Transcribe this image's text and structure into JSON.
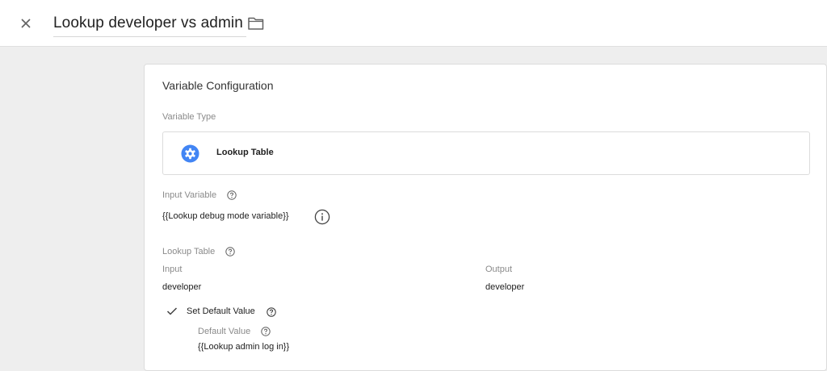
{
  "header": {
    "title": "Lookup developer vs admin",
    "close_icon": "close-icon",
    "folder_icon": "folder-icon"
  },
  "card": {
    "title": "Variable Configuration",
    "variable_type": {
      "label": "Variable Type",
      "name": "Lookup Table",
      "icon": "gear-icon",
      "icon_color": "#4285f4"
    },
    "input_variable": {
      "label": "Input Variable",
      "value": "{{Lookup debug mode variable}}"
    },
    "lookup_table": {
      "label": "Lookup Table",
      "columns": [
        "Input",
        "Output"
      ],
      "rows": [
        [
          "developer",
          "developer"
        ]
      ]
    },
    "default_value": {
      "checkbox_label": "Set Default Value",
      "checked": true,
      "label": "Default Value",
      "value": "{{Lookup admin log in}}"
    }
  }
}
